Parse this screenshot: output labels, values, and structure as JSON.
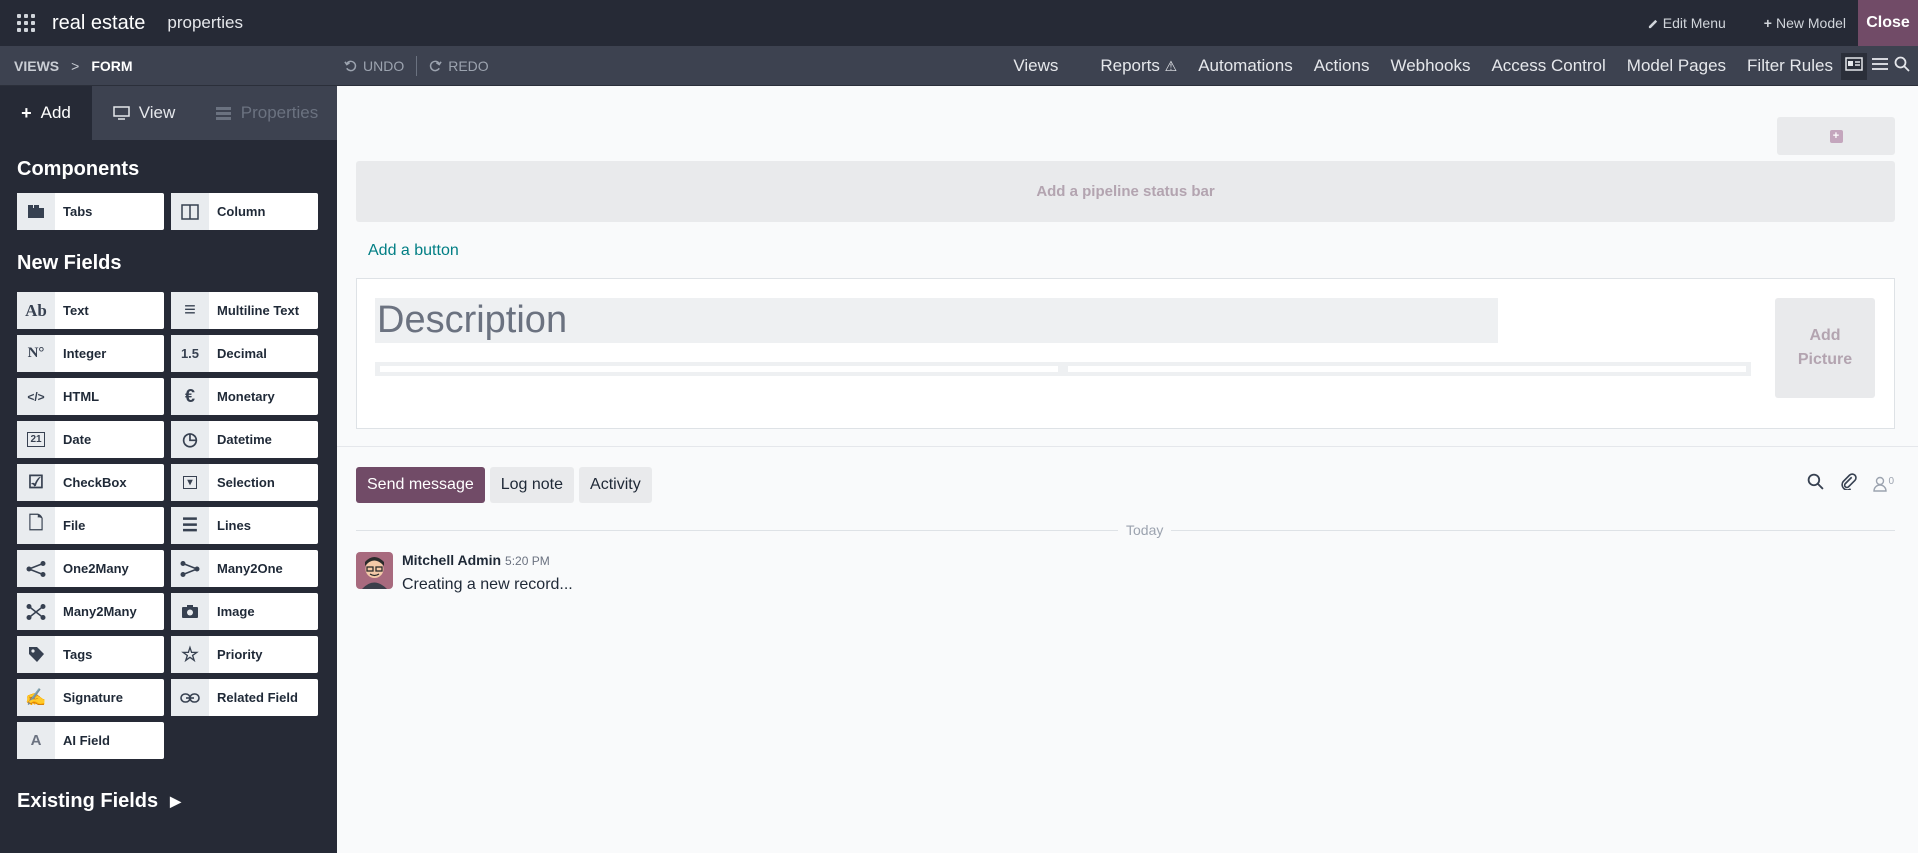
{
  "navbar": {
    "app_name": "real estate",
    "menu_item": "properties",
    "edit_menu": "Edit Menu",
    "new_model": "New Model",
    "close": "Close"
  },
  "subbar": {
    "crumb_views": "VIEWS",
    "crumb_sep": ">",
    "crumb_form": "FORM",
    "undo": "UNDO",
    "redo": "REDO",
    "nav": [
      "Views",
      "Reports",
      "Automations",
      "Actions",
      "Webhooks",
      "Access Control",
      "Model Pages",
      "Filter Rules"
    ]
  },
  "sidebar": {
    "tabs": {
      "add": "Add",
      "view": "View",
      "properties": "Properties"
    },
    "components_title": "Components",
    "components": [
      {
        "label": "Tabs",
        "icon": "tabs-icon"
      },
      {
        "label": "Column",
        "icon": "column-icon"
      }
    ],
    "new_fields_title": "New Fields",
    "fields": [
      {
        "label": "Text",
        "icon_text": "Ab"
      },
      {
        "label": "Multiline Text",
        "icon_text": "≡"
      },
      {
        "label": "Integer",
        "icon_text": "N°"
      },
      {
        "label": "Decimal",
        "icon_text": "1.5"
      },
      {
        "label": "HTML",
        "icon_text": "</>"
      },
      {
        "label": "Monetary",
        "icon_text": "€"
      },
      {
        "label": "Date",
        "icon_text": "21"
      },
      {
        "label": "Datetime",
        "icon_text": "◷"
      },
      {
        "label": "CheckBox",
        "icon_text": "☑"
      },
      {
        "label": "Selection",
        "icon_text": "▾"
      },
      {
        "label": "File",
        "icon_text": "🗋"
      },
      {
        "label": "Lines",
        "icon_text": "☰"
      },
      {
        "label": "One2Many",
        "icon_text": "<"
      },
      {
        "label": "Many2One",
        "icon_text": ">"
      },
      {
        "label": "Many2Many",
        "icon_text": "✕"
      },
      {
        "label": "Image",
        "icon_text": "◙"
      },
      {
        "label": "Tags",
        "icon_text": "⬥"
      },
      {
        "label": "Priority",
        "icon_text": "☆"
      },
      {
        "label": "Signature",
        "icon_text": "✍"
      },
      {
        "label": "Related Field",
        "icon_text": "⊂⊃"
      },
      {
        "label": "AI Field",
        "icon_text": "A"
      }
    ],
    "existing_fields": "Existing Fields"
  },
  "form": {
    "pipeline_placeholder": "Add a pipeline status bar",
    "add_button": "Add a button",
    "description_placeholder": "Description",
    "add_picture": "Add Picture"
  },
  "chatter": {
    "send_message": "Send message",
    "log_note": "Log note",
    "activity": "Activity",
    "followers_count": "0",
    "date_separator": "Today",
    "message": {
      "author": "Mitchell Admin",
      "time": "5:20 PM",
      "body": "Creating a new record..."
    }
  }
}
